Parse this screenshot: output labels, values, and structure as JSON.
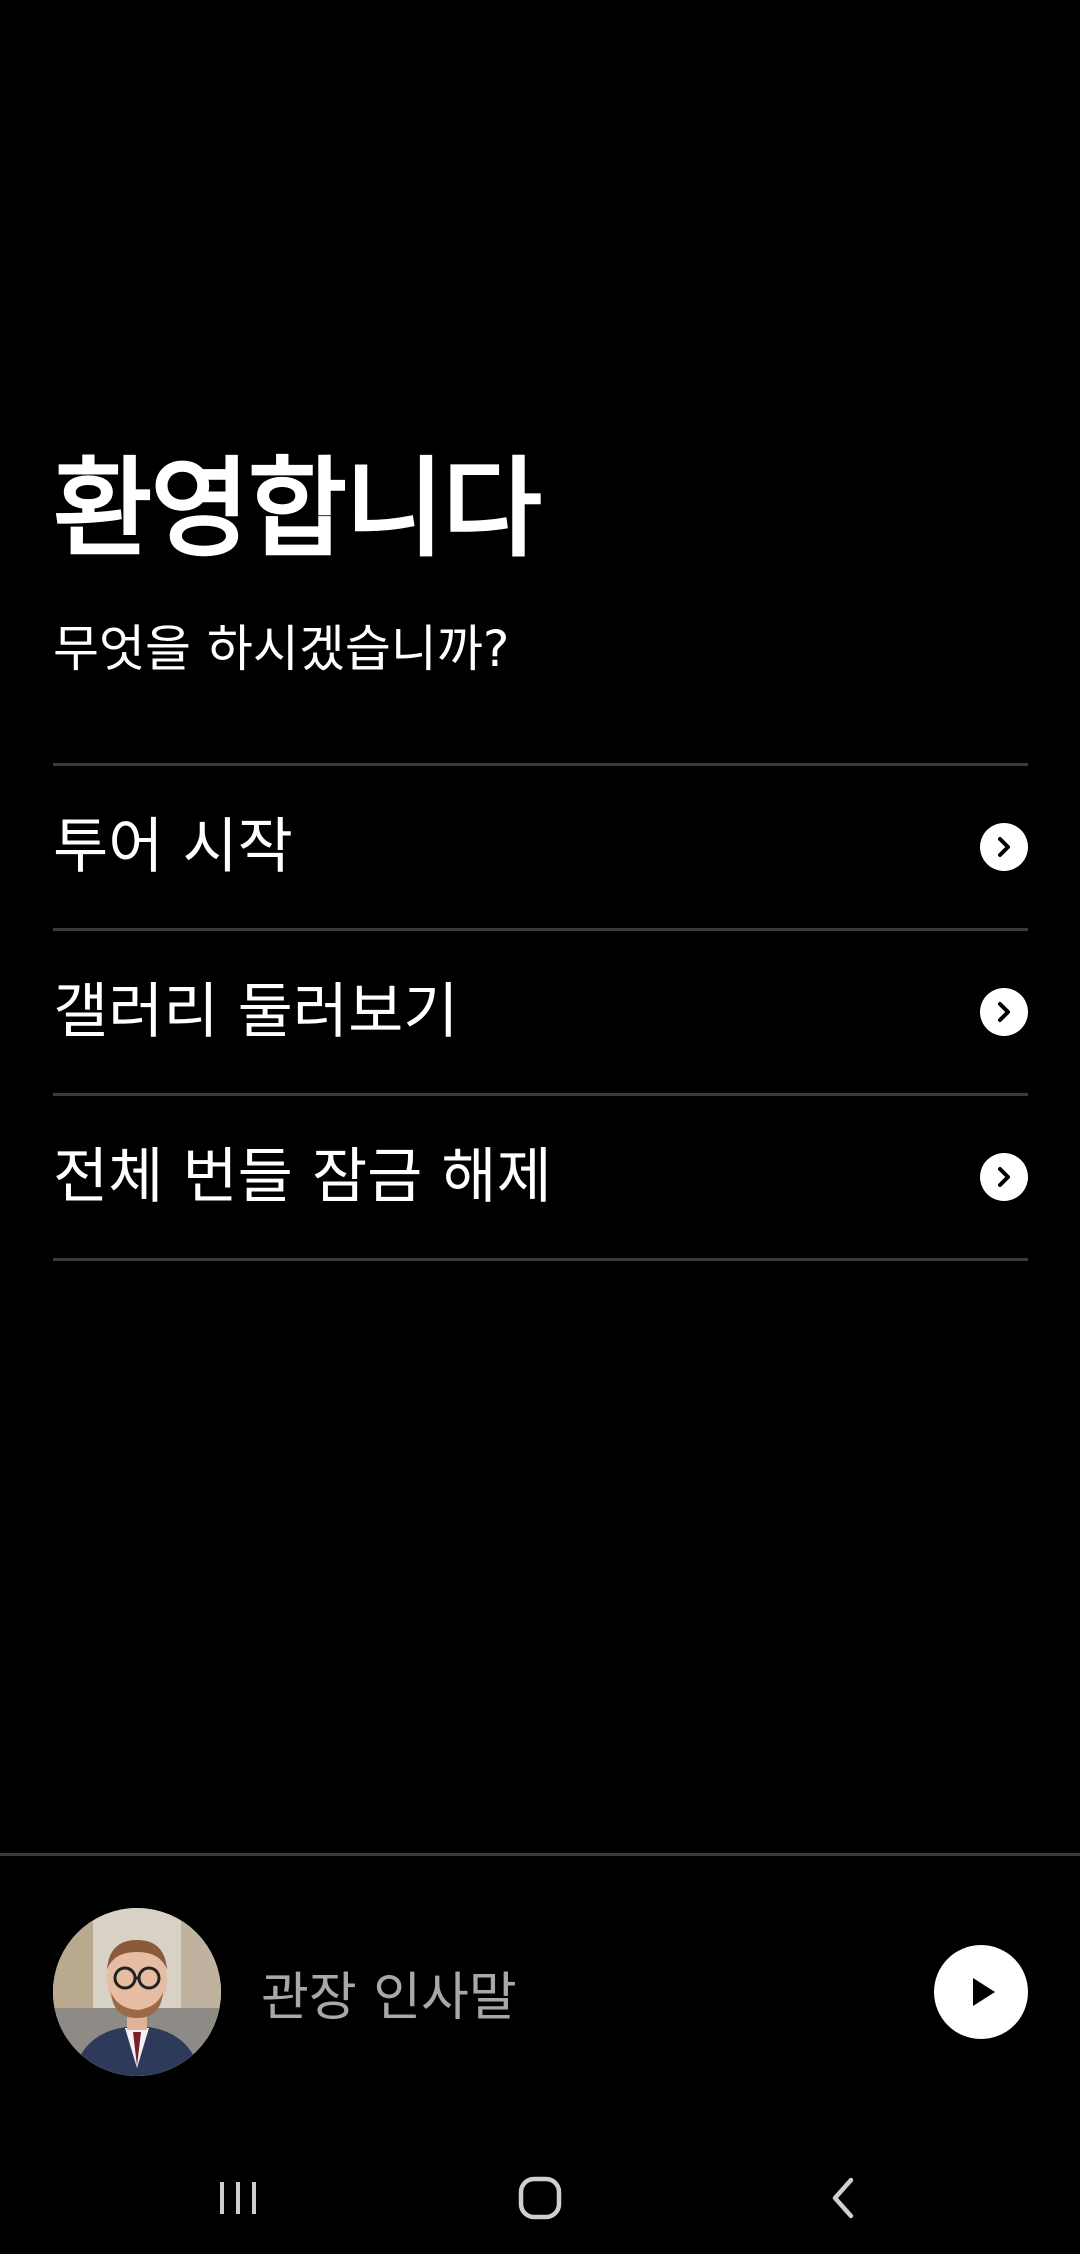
{
  "welcome": {
    "title": "환영합니다",
    "subtitle": "무엇을 하시겠습니까?"
  },
  "menu": {
    "items": [
      {
        "label": "투어 시작",
        "icon": "chevron-right-circle-icon"
      },
      {
        "label": "갤러리 둘러보기",
        "icon": "chevron-right-circle-icon"
      },
      {
        "label": "전체 번들 잠금 해제",
        "icon": "chevron-right-circle-icon"
      }
    ]
  },
  "player": {
    "label": "관장 인사말",
    "avatar_icon": "curator-portrait",
    "play_icon": "play-icon"
  },
  "system_nav": {
    "recents_icon": "recents-icon",
    "home_icon": "home-icon",
    "back_icon": "back-icon"
  },
  "colors": {
    "background": "#000000",
    "text": "#ffffff",
    "muted_text": "#a8a8a8",
    "divider": "#3a3a3a"
  }
}
